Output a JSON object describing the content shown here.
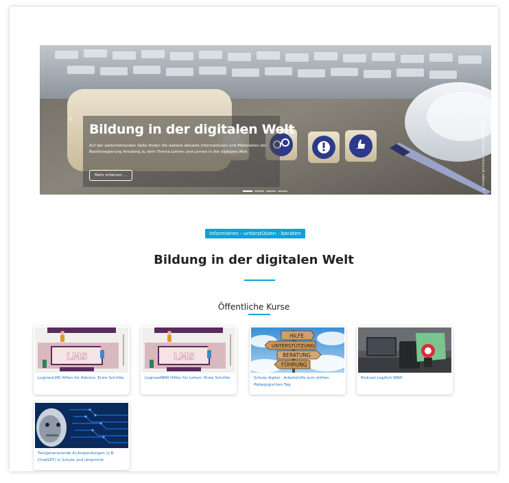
{
  "hero": {
    "title": "Bildung in der digitalen Welt",
    "text": "Auf der weiterführenden Seite finden Sie weitere aktuelle Informationen und Materialien der Bezirksregierung Arnsberg zu dem Thema Lehren und Lernen in der digitalen Welt",
    "button_label": "Mehr erfahren ...",
    "prev_icon": "chevron-left-icon",
    "next_icon": "chevron-right-icon",
    "credit": "©Imagio pictures - stock.adobe.com",
    "slide_count": 4,
    "active_slide": 1
  },
  "intro": {
    "tagline": "informieren - unterstützen - beraten",
    "title": "Bildung in der digitalen Welt"
  },
  "courses": {
    "section_title": "Öffentliche Kurse",
    "items": [
      {
        "title": "LogineoLMS Hilfen für Admins: Erste Schritte",
        "image": "lms-illustration"
      },
      {
        "title": "LogineoNRW Hilfen für Lehrer: Erste Schritte",
        "image": "lms-illustration"
      },
      {
        "title": "Schule digital - Arbeitshilfe zum dritten Pädagogischen Tag",
        "image": "signpost-photo",
        "sign_labels": [
          "HILFE",
          "UNTERSTÜTZUNG",
          "BERATUNG",
          "FÜHRUNG"
        ]
      },
      {
        "title": "Podcast LogiSch NRW",
        "image": "podcast-studio-photo"
      },
      {
        "title": "Textgenerierende KI-Anwendungen (z.B. ChatGPT) in Schule und Unterricht",
        "image": "ai-robot-photo"
      }
    ]
  },
  "colors": {
    "accent": "#0ba3d9",
    "link": "#1a72c4",
    "lms_purple": "#5b2a5e",
    "circuit_blue": "#1f6fd6"
  }
}
